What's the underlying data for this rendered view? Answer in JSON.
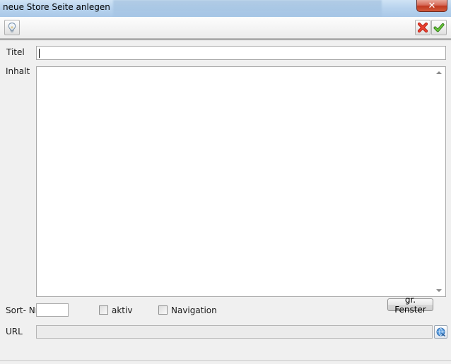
{
  "window": {
    "title": "neue Store Seite anlegen",
    "close_symbol": "✕"
  },
  "toolbar": {
    "left_icon": "lightbulb-icon",
    "cancel_icon": "red-x-icon",
    "confirm_icon": "green-check-icon"
  },
  "form": {
    "title_label": "Titel",
    "title_value": "",
    "content_label": "Inhalt",
    "content_value": "",
    "big_window_button": "gr. Fenster",
    "sort_label": "Sort- Nr.",
    "sort_value": "",
    "active_label": "aktiv",
    "active_checked": false,
    "navigation_label": "Navigation",
    "navigation_checked": false,
    "url_label": "URL",
    "url_value": "",
    "url_icon": "globe-link-icon"
  },
  "colors": {
    "titlebar": "#b9d4ee",
    "close": "#c0391f",
    "cancel_icon": "#d42a1c",
    "confirm_icon": "#3f9a1f",
    "background": "#f0f0f0"
  }
}
